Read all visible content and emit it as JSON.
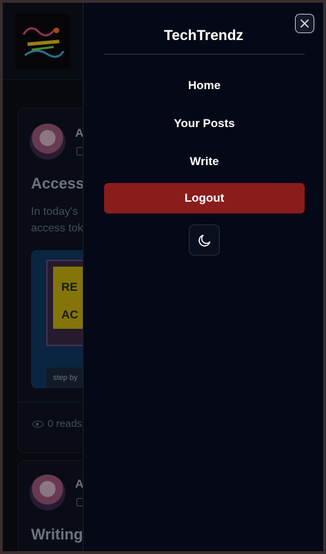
{
  "app": {
    "title": "TechTrendz"
  },
  "background": {
    "posts": [
      {
        "author": "A",
        "title": "Access T",
        "excerpt": "In today's access tok",
        "image_text": [
          "RE",
          "AC"
        ],
        "image_caption": "step by",
        "reads": "0 reads"
      },
      {
        "author": "A",
        "title": "Writing"
      }
    ]
  },
  "menu": {
    "items": [
      {
        "label": "Home"
      },
      {
        "label": "Your Posts"
      },
      {
        "label": "Write"
      },
      {
        "label": "Logout"
      }
    ],
    "close_icon": "close-icon",
    "theme_icon": "moon-icon"
  },
  "colors": {
    "logout": "#8b1c1c",
    "drawer_bg": "#050917"
  }
}
